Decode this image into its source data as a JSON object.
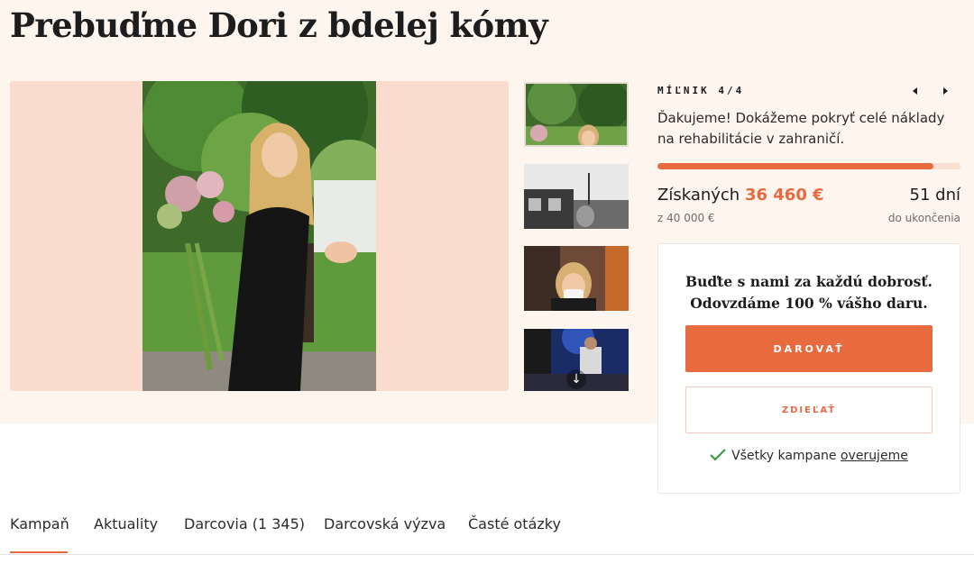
{
  "page": {
    "title": "Prebuďme Dori z bdelej kómy"
  },
  "milestone": {
    "label": "MÍĽNIK 4/4",
    "text": "Ďakujeme! Dokážeme pokryť celé náklady na rehabilitácie v zahraničí.",
    "progress": 0.91
  },
  "stats": {
    "raised_label": "Získaných",
    "raised_amount": "36 460 €",
    "goal": "z  40 000 €",
    "days": "51 dní",
    "days_sub": "do ukončenia"
  },
  "card": {
    "heading_line1": "Buďte s nami za každú dobrosť.",
    "heading_line2": "Odovzdáme 100 % vášho daru.",
    "donate_label": "DAROVAŤ",
    "share_label": "ZDIEĽAŤ",
    "verify_text": "Všetky kampane",
    "verify_link": "overujeme"
  },
  "tabs": [
    {
      "label": "Kampaň"
    },
    {
      "label": "Aktuality"
    },
    {
      "label": "Darcovia (1 345)"
    },
    {
      "label": "Darcovská výzva"
    },
    {
      "label": "Časté otázky"
    }
  ],
  "colors": {
    "accent": "#e86a3f",
    "background": "#fdf5ee",
    "image_bg": "#f9dccd"
  }
}
